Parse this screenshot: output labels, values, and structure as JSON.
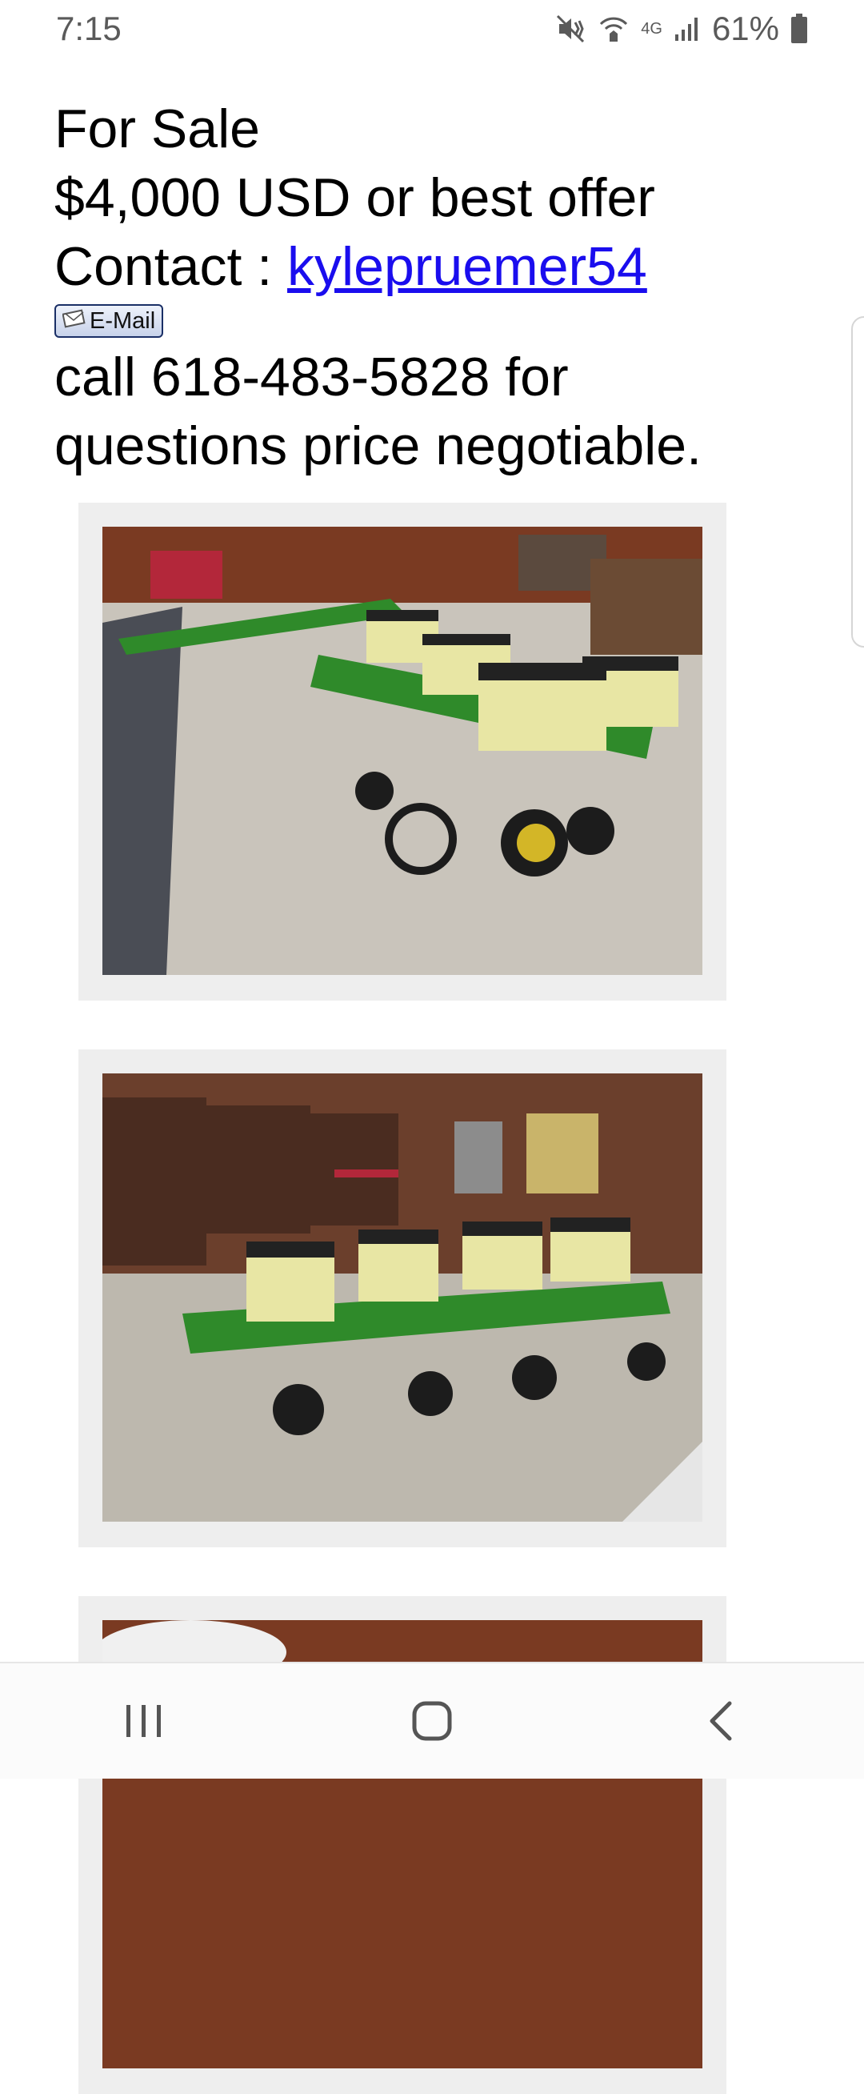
{
  "status_bar": {
    "time": "7:15",
    "network": "4G",
    "battery": "61%",
    "icons": [
      "mute-icon",
      "wifi-calling-icon",
      "signal-icon",
      "battery-icon"
    ]
  },
  "listing": {
    "heading": "For Sale",
    "price": "$4,000 USD or best offer",
    "contact_label": "Contact : ",
    "contact_user": "kylepruemer54",
    "email_button": "E-Mail",
    "phone_line1": "call 618-483-5828 for",
    "phone_line2": "questions price negotiable."
  },
  "photos": [
    {
      "icon": "planter-photo-1"
    },
    {
      "icon": "planter-photo-2"
    },
    {
      "icon": "planter-photo-3"
    }
  ],
  "nav_bar": {
    "icons": [
      "recent-apps-icon",
      "home-icon",
      "back-icon"
    ]
  },
  "colors": {
    "link": "#1a0dee",
    "frame": "#eeeeee",
    "implement_green": "#2f8a2a",
    "hopper_yellow": "#e8e6a4"
  }
}
